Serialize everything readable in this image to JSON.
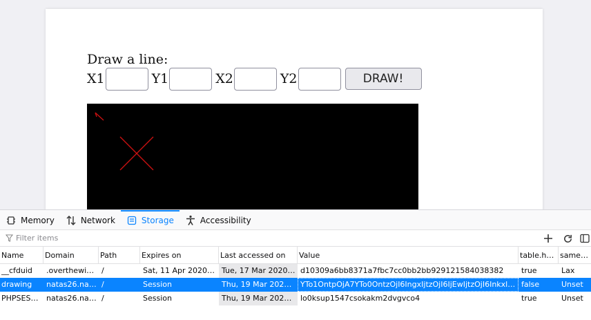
{
  "page": {
    "heading": "Draw a line:",
    "labels": {
      "x1": "X1",
      "y1": "Y1",
      "x2": "X2",
      "y2": "Y2"
    },
    "values": {
      "x1": "",
      "y1": "",
      "x2": "",
      "y2": ""
    },
    "draw_button": "DRAW!",
    "colors": {
      "canvas": "#000000",
      "line": "#cc1111"
    }
  },
  "devtools": {
    "tabs": [
      {
        "label": "Memory",
        "icon": "memory-icon"
      },
      {
        "label": "Network",
        "icon": "network-icon"
      },
      {
        "label": "Storage",
        "icon": "storage-icon",
        "selected": true
      },
      {
        "label": "Accessibility",
        "icon": "accessibility-icon"
      }
    ],
    "filter_placeholder": "Filter items",
    "toolbar_icons": [
      "add-icon",
      "refresh-icon",
      "sidebar-toggle-icon"
    ],
    "columns": [
      "Name",
      "Domain",
      "Path",
      "Expires on",
      "Last accessed on",
      "Value",
      "table.he...",
      "sameSite"
    ],
    "rows": [
      {
        "name": "__cfduid",
        "domain": ".overthewire...",
        "path": "/",
        "expires": "Sat, 11 Apr 2020 18:...",
        "accessed": "Tue, 17 Mar 2020 17...",
        "value": "d10309a6bb8371a7fbc7cc0bb2bb929121584038382",
        "http": "true",
        "samesite": "Lax"
      },
      {
        "name": "drawing",
        "domain": "natas26.nat...",
        "path": "/",
        "expires": "Session",
        "accessed": "Thu, 19 Mar 2020 1...",
        "value": "YTo1OntpOjA7YTo0OntzOjI6IngxIjtzOjI6IjEwIjtzOjI6Inkxljtz...",
        "http": "false",
        "samesite": "Unset",
        "selected": true
      },
      {
        "name": "PHPSESS...",
        "domain": "natas26.nat...",
        "path": "/",
        "expires": "Session",
        "accessed": "Thu, 19 Mar 2020 1...",
        "value": "lo0ksup1547csokakm2dvgvco4",
        "http": "true",
        "samesite": "Unset"
      }
    ],
    "colors": {
      "accent": "#0a84ff"
    }
  }
}
